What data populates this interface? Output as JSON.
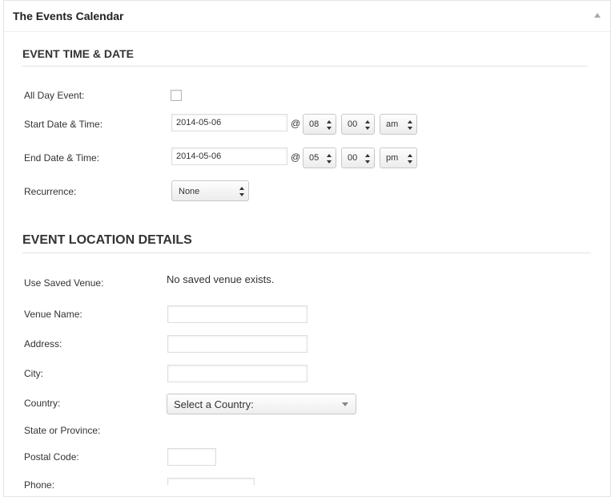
{
  "header": {
    "title": "The Events Calendar"
  },
  "time_date": {
    "title": "EVENT TIME & DATE",
    "all_day_label": "All Day Event:",
    "start_label": "Start Date & Time:",
    "start_date": "2014-05-06",
    "start_hour": "08",
    "start_minute": "00",
    "start_meridian": "am",
    "end_label": "End Date & Time:",
    "end_date": "2014-05-06",
    "end_hour": "05",
    "end_minute": "00",
    "end_meridian": "pm",
    "at_symbol": "@",
    "recurrence_label": "Recurrence:",
    "recurrence_value": "None"
  },
  "location": {
    "title": "EVENT LOCATION DETAILS",
    "saved_venue_label": "Use Saved Venue:",
    "saved_venue_text": "No saved venue exists.",
    "venue_name_label": "Venue Name:",
    "address_label": "Address:",
    "city_label": "City:",
    "country_label": "Country:",
    "country_value": "Select a Country:",
    "state_label": "State or Province:",
    "postal_label": "Postal Code:",
    "phone_label": "Phone:"
  }
}
